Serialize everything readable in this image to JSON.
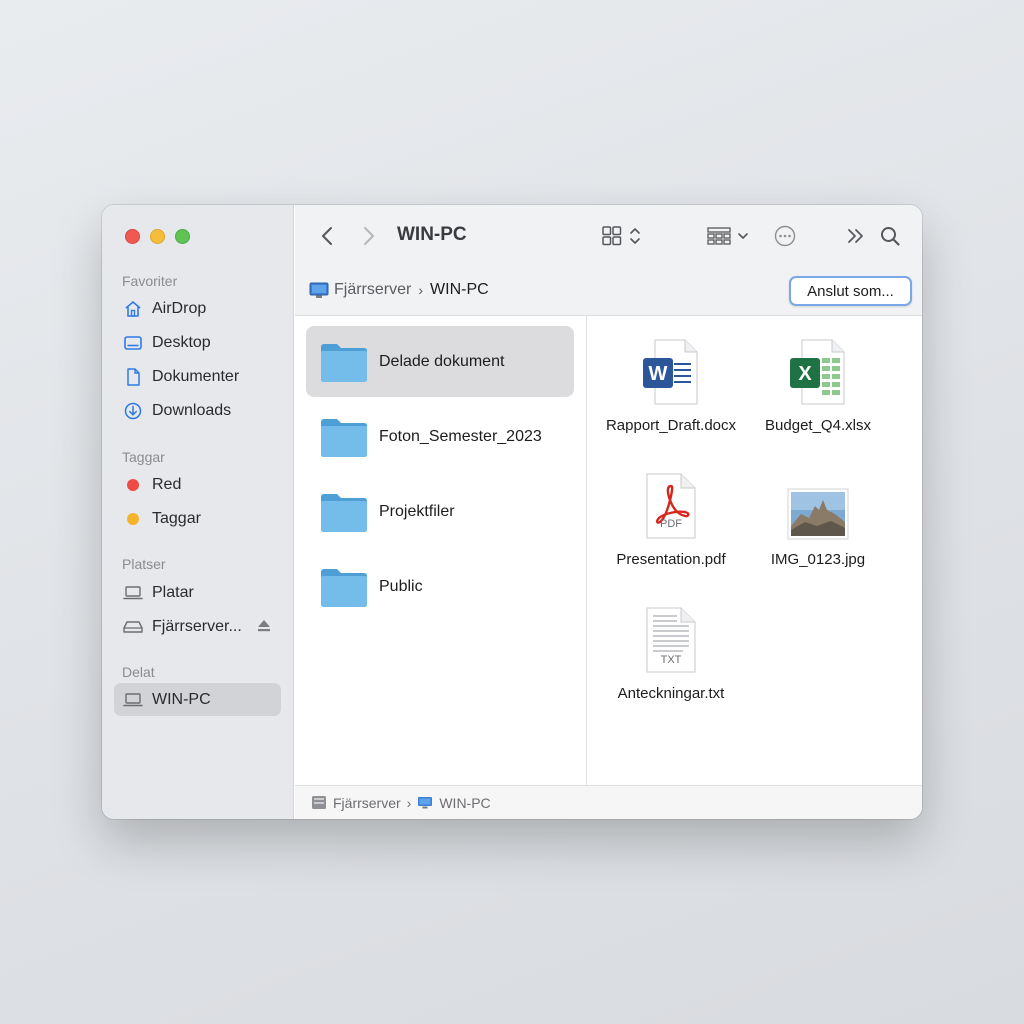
{
  "window": {
    "title": "WIN-PC"
  },
  "sidebar": {
    "favorites_heading": "Favoriter",
    "favorites": [
      {
        "label": "AirDrop",
        "icon": "airdrop-icon"
      },
      {
        "label": "Desktop",
        "icon": "desktop-icon"
      },
      {
        "label": "Dokumenter",
        "icon": "document-icon"
      },
      {
        "label": "Downloads",
        "icon": "download-icon"
      }
    ],
    "tags_heading": "Taggar",
    "tags": [
      {
        "label": "Red",
        "color": "#ee4b47"
      },
      {
        "label": "Taggar",
        "color": "#f4b32a"
      }
    ],
    "places_heading": "Platser",
    "places": [
      {
        "label": "Platar",
        "icon": "laptop-icon"
      },
      {
        "label": "Fjärrserver...",
        "icon": "drive-icon",
        "eject": "eject-icon"
      }
    ],
    "shared_heading": "Delat",
    "shared": [
      {
        "label": "WIN-PC",
        "icon": "laptop-icon",
        "selected": true
      }
    ]
  },
  "toolbar": {
    "back": "chevron-left-icon",
    "forward": "chevron-right-icon",
    "view_toggle": "grid-view-icon",
    "group_menu": "group-icon",
    "action_menu": "ellipsis-circle-icon",
    "more": "double-chevron-icon",
    "search": "search-icon"
  },
  "pathbar": {
    "root": "Fjärrserver",
    "current": "WIN-PC",
    "connect_button": "Anslut som..."
  },
  "folders": [
    {
      "name": "Delade dokument",
      "selected": true
    },
    {
      "name": "Foton_Semester_2023",
      "selected": false
    },
    {
      "name": "Projektfiler",
      "selected": false
    },
    {
      "name": "Public",
      "selected": false
    }
  ],
  "files": [
    {
      "name": "Rapport_Draft.docx",
      "kind": "word"
    },
    {
      "name": "Budget_Q4.xlsx",
      "kind": "excel"
    },
    {
      "name": "Presentation.pdf",
      "kind": "pdf",
      "badge": "PDF"
    },
    {
      "name": "IMG_0123.jpg",
      "kind": "image"
    },
    {
      "name": "Anteckningar.txt",
      "kind": "text",
      "badge": "TXT"
    }
  ],
  "statusbar": {
    "root": "Fjärrserver",
    "current": "WIN-PC"
  },
  "colors": {
    "folder": "#6ab8e8",
    "selection": "#dcdcde",
    "accent": "#7aa7e6"
  }
}
